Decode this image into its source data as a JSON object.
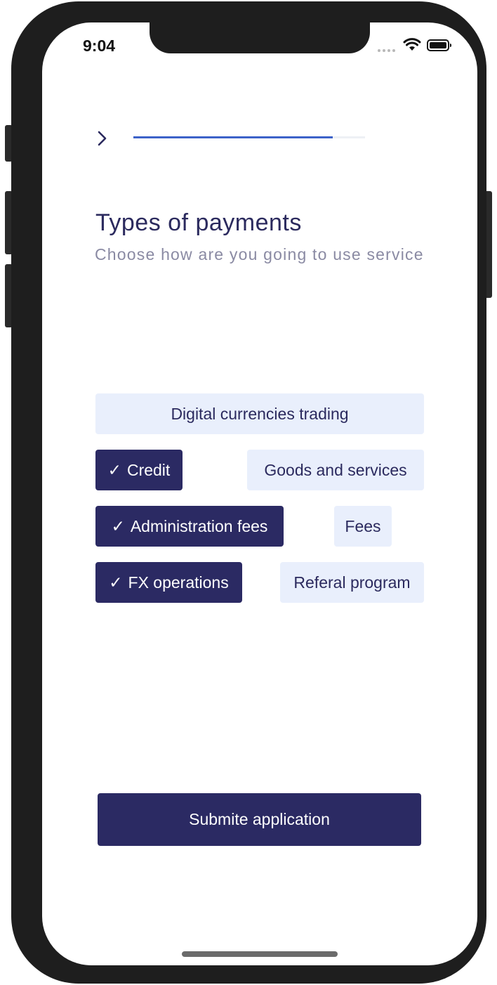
{
  "status_bar": {
    "time": "9:04"
  },
  "progress": {
    "fraction": 0.86
  },
  "header": {
    "title": "Types of payments",
    "subtitle": "Choose how are you going to use service"
  },
  "options": [
    {
      "label": "Digital currencies trading",
      "selected": false
    },
    {
      "label": "Credit",
      "selected": true
    },
    {
      "label": "Goods and services",
      "selected": false
    },
    {
      "label": "Administration fees",
      "selected": true
    },
    {
      "label": "Fees",
      "selected": false
    },
    {
      "label": "FX operations",
      "selected": true
    },
    {
      "label": "Referal program",
      "selected": false
    }
  ],
  "check_glyph": "✓",
  "submit": {
    "label": "Submite application"
  },
  "colors": {
    "accent": "#2b2a63",
    "chip_bg": "#e9effc",
    "progress": "#3d63c9",
    "subtitle": "#8a8aa3"
  }
}
